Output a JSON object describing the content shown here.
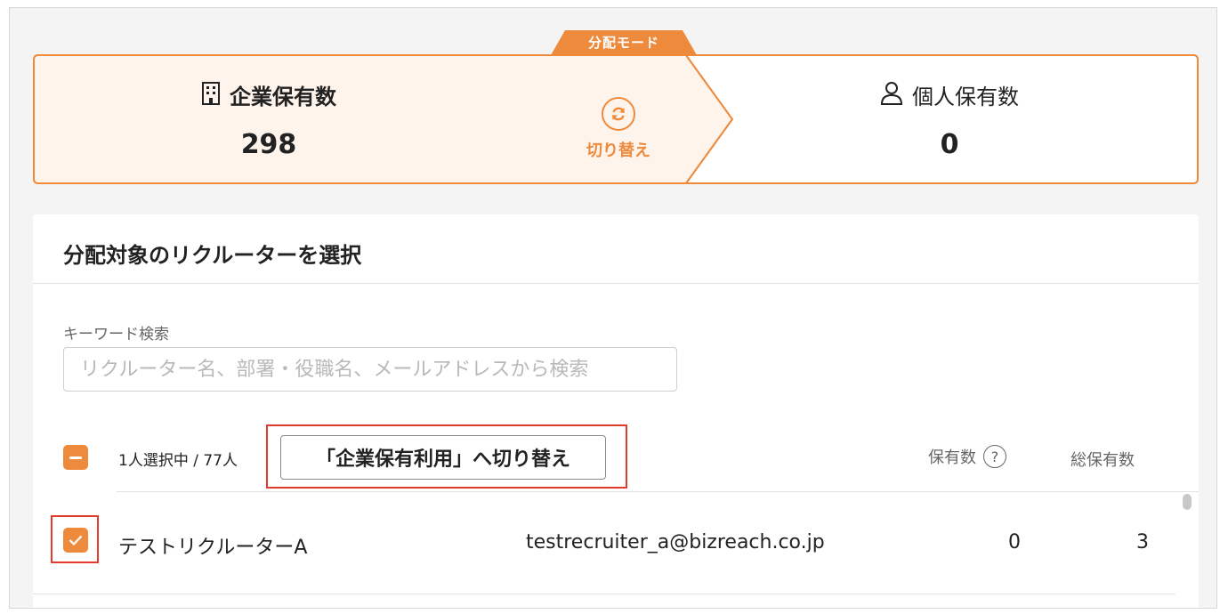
{
  "distribution": {
    "mode_label": "分配モード",
    "corporate": {
      "title": "企業保有数",
      "count": "298",
      "icon": "building-icon"
    },
    "switch": {
      "label": "切り替え",
      "icon": "refresh-icon"
    },
    "personal": {
      "title": "個人保有数",
      "count": "0",
      "icon": "person-icon"
    },
    "accent_color": "#ee8a3c",
    "highlight_color": "#e23b2e"
  },
  "panel": {
    "title": "分配対象のリクルーターを選択",
    "search": {
      "label": "キーワード検索",
      "placeholder": "リクルーター名、部署・役職名、メールアドレスから検索",
      "value": ""
    },
    "selection": {
      "count_text": "1人選択中 / 77人",
      "switch_button_label": "「企業保有利用」へ切り替え"
    },
    "columns": {
      "holdings": "保有数",
      "total": "総保有数"
    },
    "rows": [
      {
        "name": "テストリクルーターA",
        "email": "testrecruiter_a@bizreach.co.jp",
        "holdings": "0",
        "total": "3",
        "checked": true
      }
    ]
  }
}
